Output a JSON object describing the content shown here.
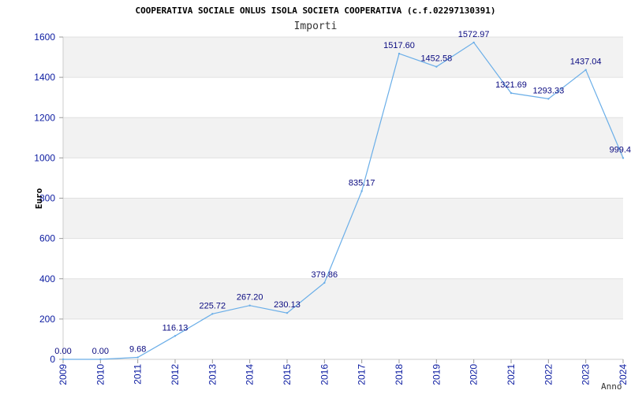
{
  "chart_data": {
    "type": "line",
    "title": "COOPERATIVA SOCIALE ONLUS ISOLA SOCIETA COOPERATIVA (c.f.02297130391)",
    "subtitle": "Importi",
    "xlabel": "Anno",
    "ylabel": "Euro",
    "x": [
      "2009",
      "2010",
      "2011",
      "2012",
      "2013",
      "2014",
      "2015",
      "2016",
      "2017",
      "2018",
      "2019",
      "2020",
      "2021",
      "2022",
      "2023",
      "2024"
    ],
    "values": [
      0,
      0,
      9.68,
      116.13,
      225.72,
      267.2,
      230.13,
      379.86,
      835.17,
      1517.6,
      1452.58,
      1572.97,
      1321.69,
      1293.33,
      1437.04,
      999.4
    ],
    "labels": [
      "0.00",
      "0.00",
      "9.68",
      "116.13",
      "225.72",
      "267.20",
      "230.13",
      "379.86",
      "835.17",
      "1517.60",
      "1452.58",
      "1572.97",
      "1321.69",
      "1293.33",
      "1437.04",
      "999.4"
    ],
    "label_year_index": [
      0,
      1,
      2,
      3,
      4,
      5,
      6,
      7,
      8,
      9,
      10,
      11,
      12,
      13,
      14,
      15
    ],
    "y_ticks": [
      0,
      200,
      400,
      600,
      800,
      1000,
      1200,
      1400,
      1600
    ],
    "ylim": [
      0,
      1600
    ],
    "grid": true,
    "line_color": "#6aaee8",
    "band_color": "#f2f2f2",
    "tick_color": "#0a1aa0"
  }
}
